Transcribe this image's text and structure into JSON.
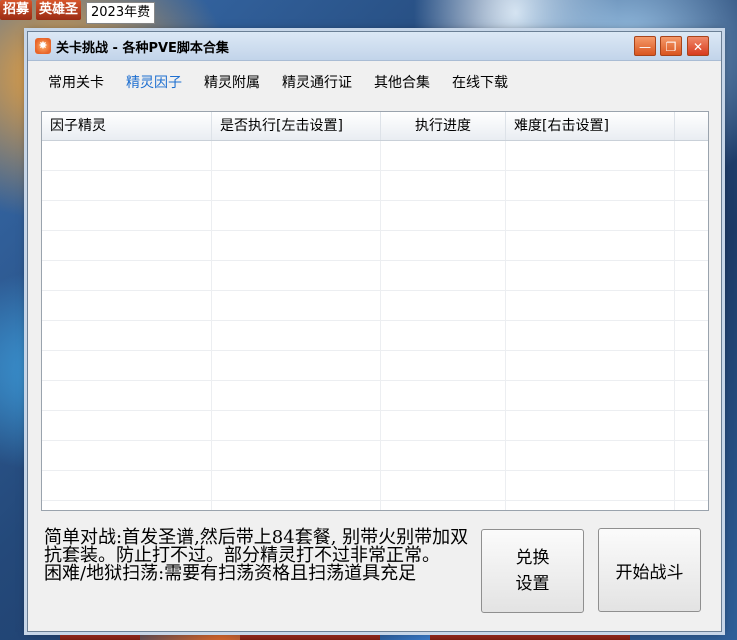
{
  "background": {
    "tag_recruit": "招募",
    "tag_hero": "英雄圣",
    "tag_yearfee": "2023年费"
  },
  "window": {
    "title": "关卡挑战 - 各种PVE脚本合集",
    "icon": "app-logo-icon",
    "controls": [
      "minimize-icon",
      "maximize-icon",
      "close-icon"
    ]
  },
  "tabs": [
    {
      "label": "常用关卡",
      "active": false
    },
    {
      "label": "精灵因子",
      "active": true
    },
    {
      "label": "精灵附属",
      "active": false
    },
    {
      "label": "精灵通行证",
      "active": false
    },
    {
      "label": "其他合集",
      "active": false
    },
    {
      "label": "在线下载",
      "active": false
    }
  ],
  "table": {
    "columns": [
      "因子精灵",
      "是否执行[左击设置]",
      "执行进度",
      "难度[右击设置]",
      ""
    ],
    "rows": []
  },
  "notes": {
    "line1": "简单对战:首发圣谱,然后带上84套餐, 别带火别带加双抗套装。防止打不过。部分精灵打不过非常正常。",
    "line2": "困难/地狱扫荡:需要有扫荡资格且扫荡道具充足"
  },
  "buttons": {
    "exchange_line1": "兑换",
    "exchange_line2": "设置",
    "start": "开始战斗"
  },
  "colors": {
    "active_tab": "#1e6fd0",
    "window_bg": "#f0f0f0",
    "window_controls": "#e8652a"
  }
}
